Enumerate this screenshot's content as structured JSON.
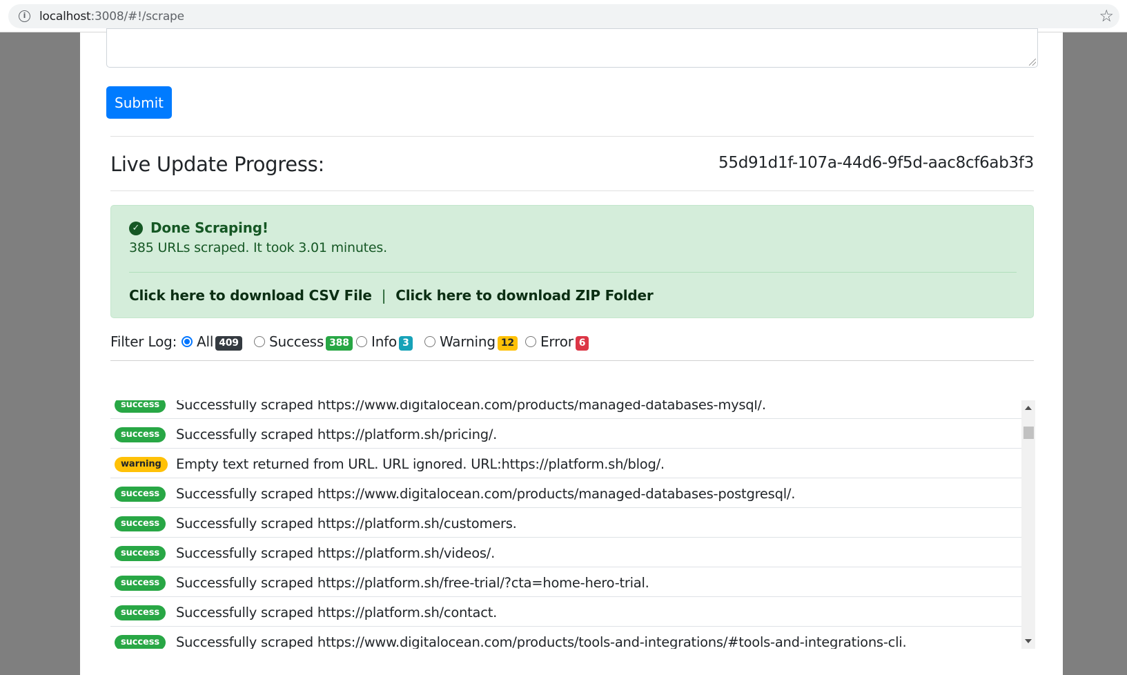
{
  "browser": {
    "url_host": "localhost",
    "url_path": ":3008/#!/scrape",
    "info_icon": "i",
    "star_icon": "☆"
  },
  "form": {
    "submit_label": "Submit"
  },
  "progress": {
    "title": "Live Update Progress:",
    "job_id": "55d91d1f-107a-44d6-9f5d-aac8cf6ab3f3"
  },
  "alert": {
    "icon": "✓",
    "title": "Done Scraping!",
    "message": "385 URLs scraped. It took 3.01 minutes.",
    "csv_link": "Click here to download CSV File",
    "separator": "|",
    "zip_link": "Click here to download ZIP Folder"
  },
  "filter": {
    "label": "Filter Log:",
    "options": [
      {
        "label": "All",
        "count": "409"
      },
      {
        "label": "Success",
        "count": "388"
      },
      {
        "label": "Info",
        "count": "3"
      },
      {
        "label": "Warning",
        "count": "12"
      },
      {
        "label": "Error",
        "count": "6"
      }
    ]
  },
  "log": [
    {
      "level": "success",
      "text": "Successfully scraped https://www.digitalocean.com/products/managed-databases-mysql/."
    },
    {
      "level": "success",
      "text": "Successfully scraped https://platform.sh/pricing/."
    },
    {
      "level": "warning",
      "text": "Empty text returned from URL. URL ignored. URL:https://platform.sh/blog/."
    },
    {
      "level": "success",
      "text": "Successfully scraped https://www.digitalocean.com/products/managed-databases-postgresql/."
    },
    {
      "level": "success",
      "text": "Successfully scraped https://platform.sh/customers."
    },
    {
      "level": "success",
      "text": "Successfully scraped https://platform.sh/videos/."
    },
    {
      "level": "success",
      "text": "Successfully scraped https://platform.sh/free-trial/?cta=home-hero-trial."
    },
    {
      "level": "success",
      "text": "Successfully scraped https://platform.sh/contact."
    },
    {
      "level": "success",
      "text": "Successfully scraped https://www.digitalocean.com/products/tools-and-integrations/#tools-and-integrations-cli."
    }
  ]
}
